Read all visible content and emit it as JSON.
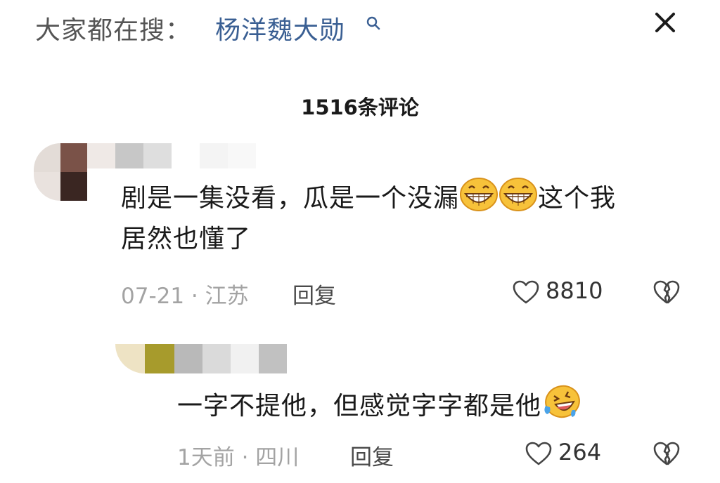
{
  "hint": {
    "prefix": "大家都在搜：",
    "term": "杨洋魏大勋",
    "search_icon": "search-icon",
    "close_icon": "close-icon"
  },
  "comments_header": {
    "title": "1516条评论"
  },
  "comments": [
    {
      "text_part1": "剧是一集没看，瓜是一个没漏",
      "emoji1": "grin-emoji",
      "emoji2": "grin-emoji",
      "text_part2": "这个我",
      "text_line2": "居然也懂了",
      "date_loc": "07-21 · 江苏",
      "reply_label": "回复",
      "likes": "8810",
      "like_icon": "heart-icon",
      "dislike_icon": "broken-heart-icon"
    },
    {
      "text_part1": "一字不提他，但感觉字字都是他",
      "emoji1": "laughing-crying-emoji",
      "date_loc": "1天前 · 四川",
      "reply_label": "回复",
      "likes": "264",
      "like_icon": "heart-icon",
      "dislike_icon": "broken-heart-icon"
    }
  ],
  "colors": {
    "link_blue": "#3a5f93",
    "meta_gray": "#a3a3a3",
    "emoji_yellow": "#f7c23a"
  }
}
